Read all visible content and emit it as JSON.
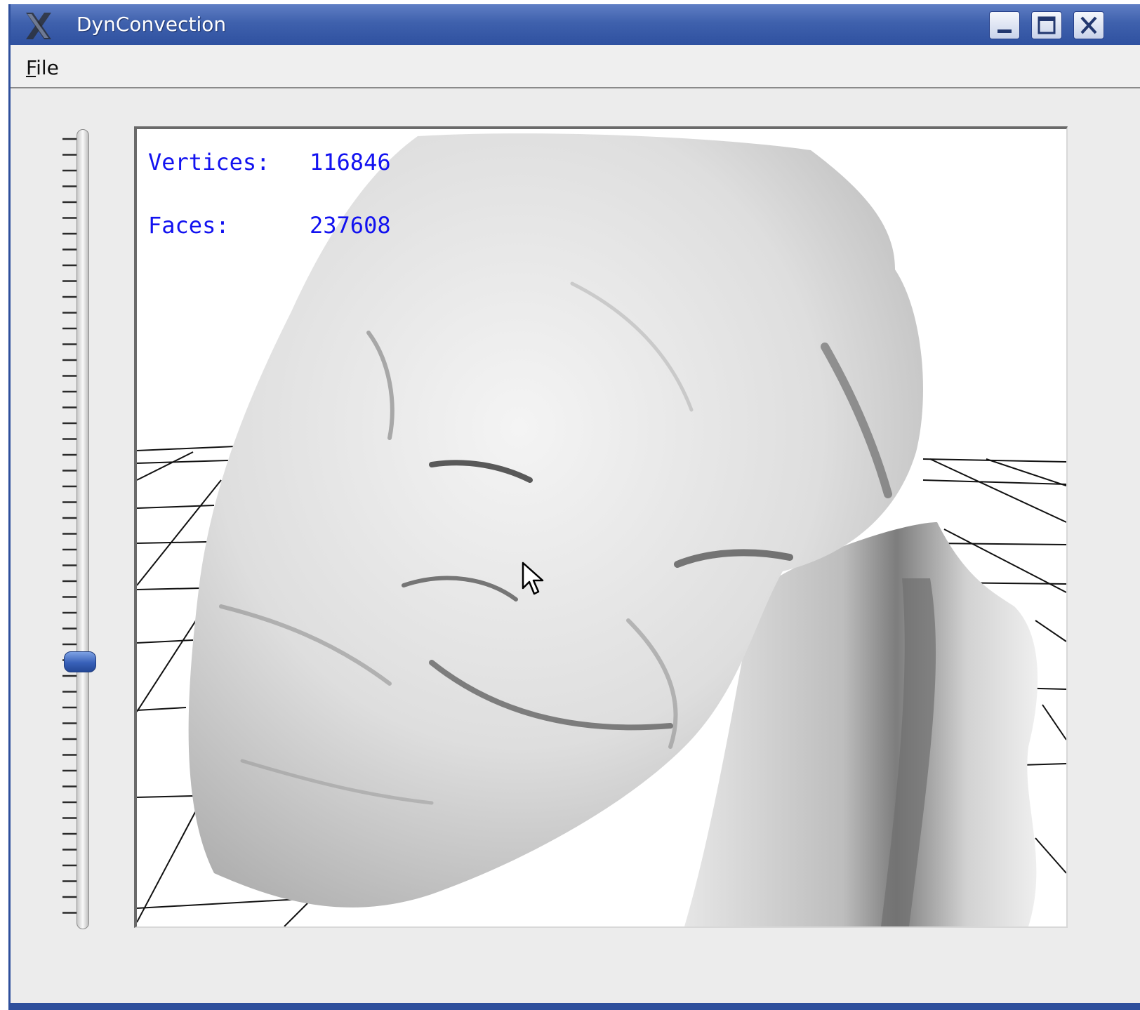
{
  "window": {
    "title": "DynConvection"
  },
  "menu": {
    "file_mnemonic": "F",
    "file_rest": "ile"
  },
  "slider": {
    "fraction": 0.33
  },
  "stats": {
    "vertices_label": "Vertices:",
    "vertices_value": "116846",
    "faces_label": "Faces:",
    "faces_value": "237608",
    "text_color": "#1212f0"
  },
  "icons": {
    "app": "x-logo-icon",
    "minimize": "minimize-icon",
    "maximize": "maximize-icon",
    "close": "close-icon",
    "cursor": "mouse-pointer-icon"
  },
  "colors": {
    "titlebar": "#3f61ad",
    "window_bg": "#ececec",
    "viewport_bg": "#ffffff",
    "slider_handle": "#3860b8"
  }
}
